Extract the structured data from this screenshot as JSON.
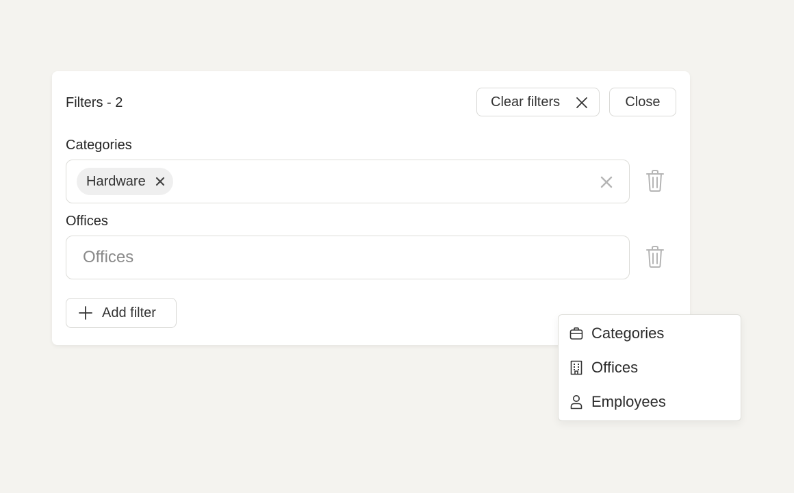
{
  "panel": {
    "title": "Filters - 2",
    "clear_filters_label": "Clear filters",
    "close_label": "Close"
  },
  "filters": [
    {
      "label": "Categories",
      "selected_chips": [
        "Hardware"
      ]
    },
    {
      "label": "Offices",
      "placeholder": "Offices",
      "value": ""
    }
  ],
  "add_filter_label": "Add filter",
  "dropdown": {
    "items": [
      {
        "label": "Categories",
        "icon": "briefcase-icon"
      },
      {
        "label": "Offices",
        "icon": "building-icon"
      },
      {
        "label": "Employees",
        "icon": "person-icon"
      }
    ]
  },
  "colors": {
    "background": "#f4f3ef",
    "panel": "#ffffff",
    "border": "#dcdcd8",
    "chip": "#efefef",
    "muted_icon": "#b5b5b5"
  }
}
